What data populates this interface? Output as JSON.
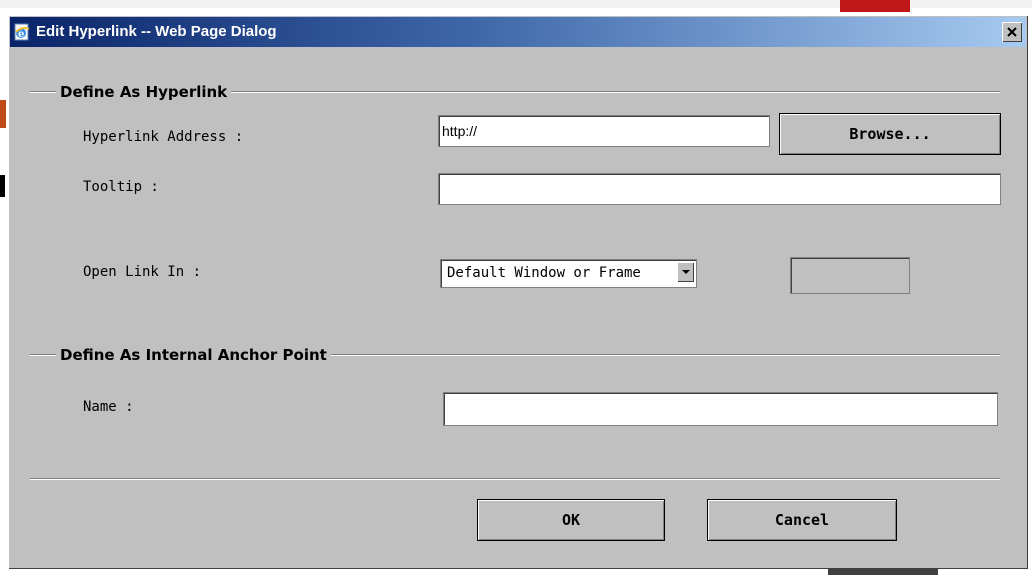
{
  "window": {
    "title": "Edit Hyperlink -- Web Page Dialog",
    "close_label": "x"
  },
  "hyperlink_group": {
    "title": "Define As Hyperlink",
    "address_label": "Hyperlink Address :",
    "address_value": "http://",
    "browse_label": "Browse...",
    "tooltip_label": "Tooltip :",
    "tooltip_value": "",
    "open_link_label": "Open Link In :",
    "open_link_selected": "Default Window or Frame",
    "frame_name_value": ""
  },
  "anchor_group": {
    "title": "Define As Internal Anchor Point",
    "name_label": "Name :",
    "name_value": ""
  },
  "footer": {
    "ok_label": "OK",
    "cancel_label": "Cancel"
  },
  "icons": {
    "title": "ie-page-icon",
    "close": "close-icon",
    "dropdown": "chevron-down-icon"
  },
  "colors": {
    "dialog_bg": "#c0c0c0",
    "titlebar_start": "#0a246a",
    "titlebar_end": "#a6caf0",
    "title_text": "#ffffff"
  }
}
